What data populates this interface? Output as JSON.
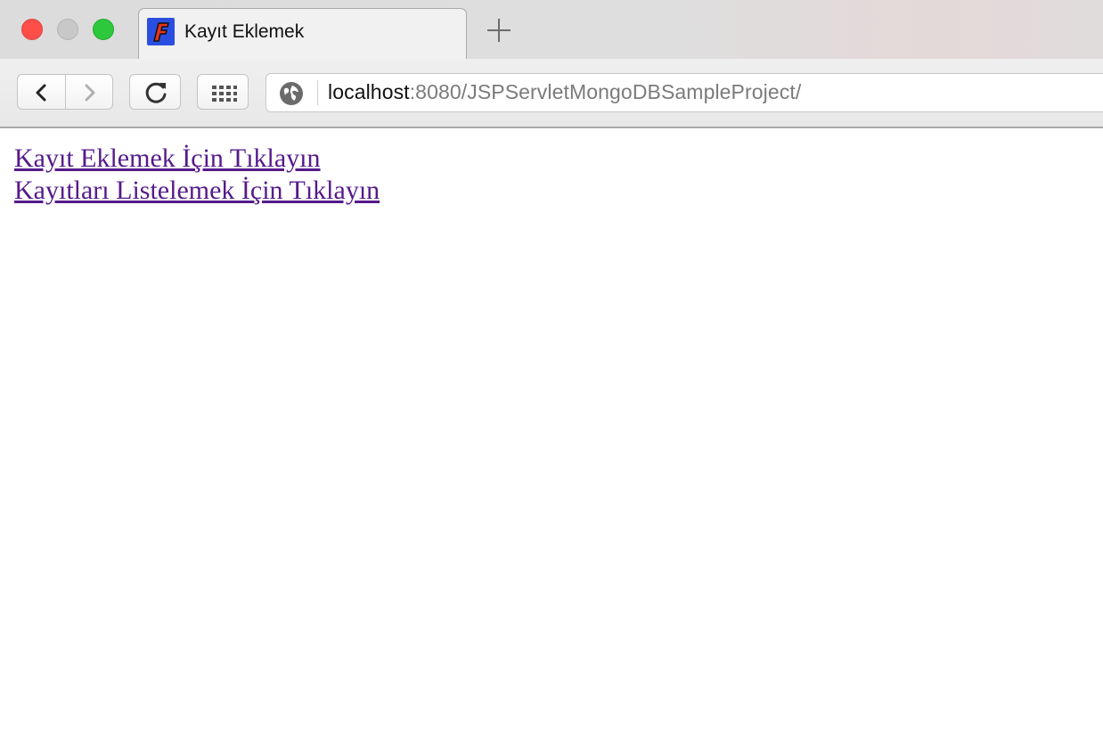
{
  "window": {
    "traffic_lights": [
      "close",
      "minimize",
      "maximize"
    ],
    "colors": {
      "close": "#fd4e4a",
      "minimize": "#c8c8c8",
      "maximize": "#2dc83b"
    }
  },
  "tab": {
    "title": "Kayıt Eklemek",
    "favicon": "java-app-favicon-icon"
  },
  "toolbar": {
    "back_icon": "chevron-left-icon",
    "forward_icon": "chevron-right-icon",
    "reload_icon": "reload-icon",
    "apps_icon": "apps-grid-icon",
    "new_tab_icon": "plus-icon"
  },
  "address_bar": {
    "site_icon": "globe-icon",
    "host": "localhost",
    "rest": ":8080/JSPServletMongoDBSampleProject/"
  },
  "page": {
    "links": [
      {
        "text": "Kayıt Eklemek İçin Tıklayın"
      },
      {
        "text": "Kayıtları Listelemek İçin Tıklayın"
      }
    ],
    "link_color": "#551a8b"
  }
}
